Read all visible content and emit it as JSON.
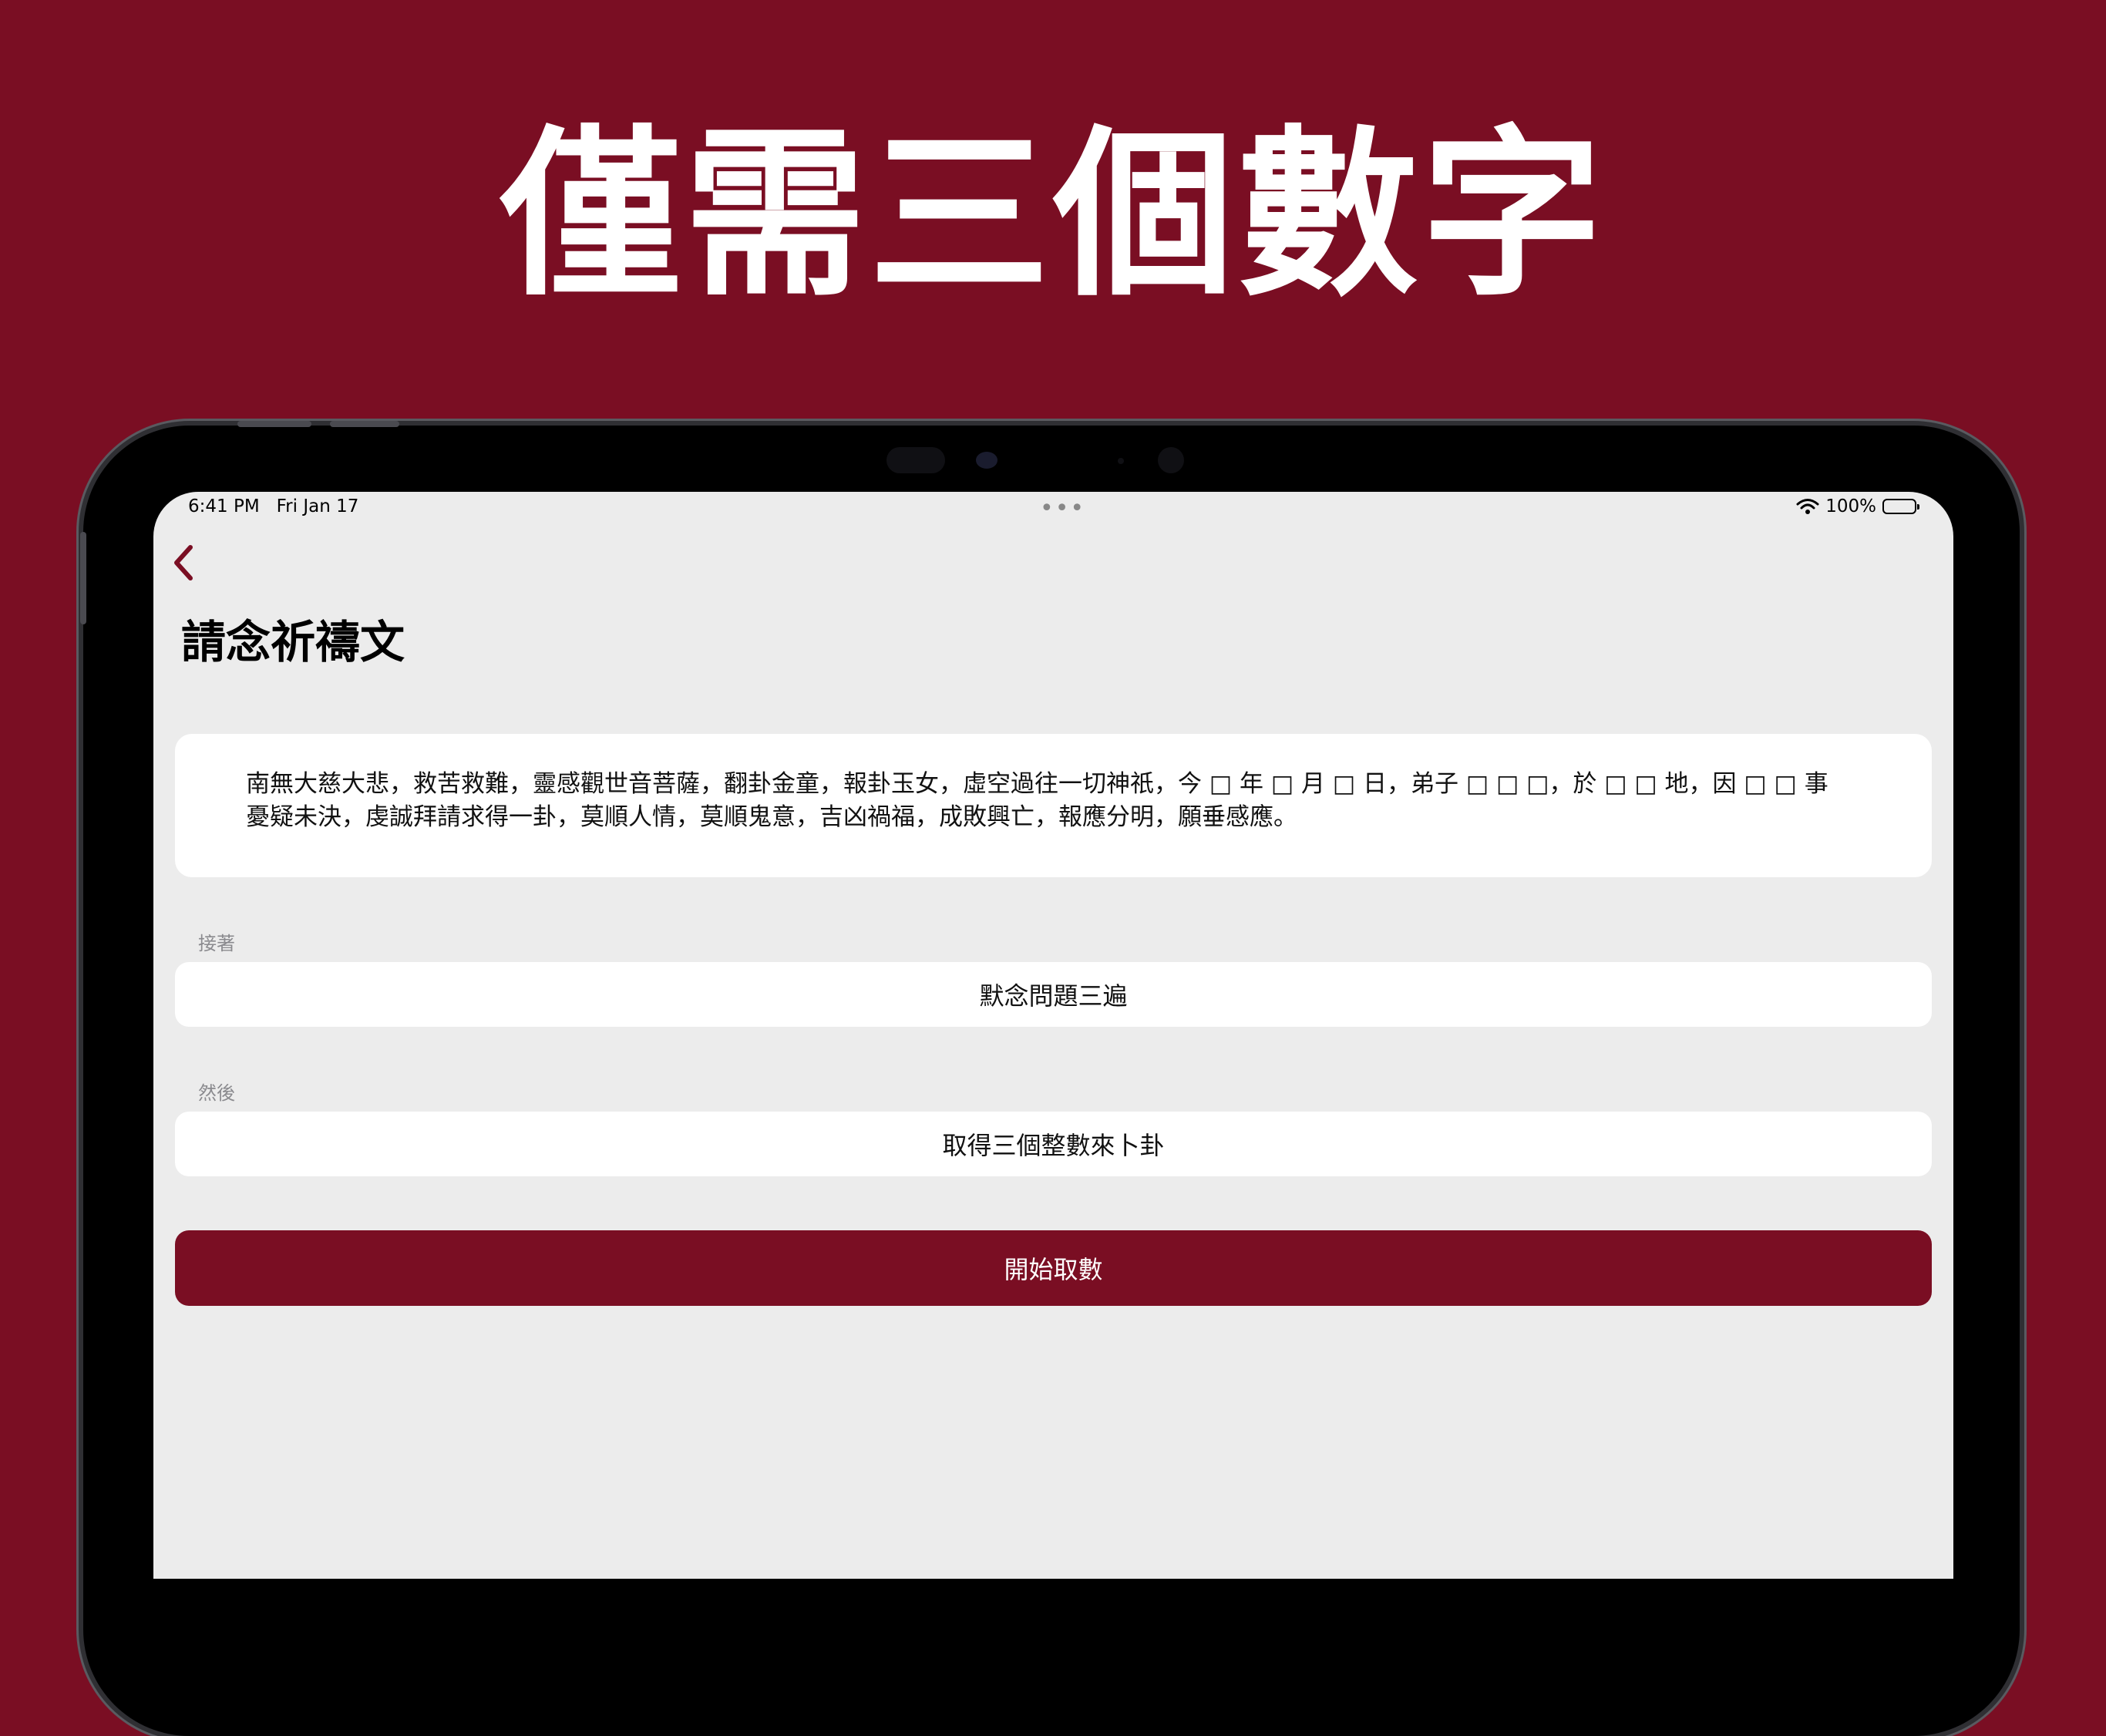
{
  "headline": "僅需三個數字",
  "status_bar": {
    "time": "6:41 PM   Fri Jan 17",
    "multitask_dots": "•••",
    "battery_text": "100%"
  },
  "nav": {
    "back_icon": "chevron-left-icon",
    "title": "請念祈禱文"
  },
  "prayer": {
    "line1": "南無大慈大悲，救苦救難，靈感觀世音菩薩，翻卦金童，報卦玉女，虛空過往一切神祇，今 □ 年 □ 月 □ 日，弟子 □ □ □，於 □ □ 地，因 □ □ 事",
    "line2": "憂疑未決，虔誠拜請求得一卦，莫順人情，莫順鬼意，吉凶禍福，成敗興亡，報應分明，願垂感應。"
  },
  "steps": [
    {
      "label": "接著",
      "text": "默念問題三遍"
    },
    {
      "label": "然後",
      "text": "取得三個整數來卜卦"
    }
  ],
  "start_button": "開始取數",
  "colors": {
    "brand": "#7a0e23",
    "screen_bg": "#ececec",
    "card_bg": "#ffffff",
    "secondary_text": "#8a8a8e"
  }
}
